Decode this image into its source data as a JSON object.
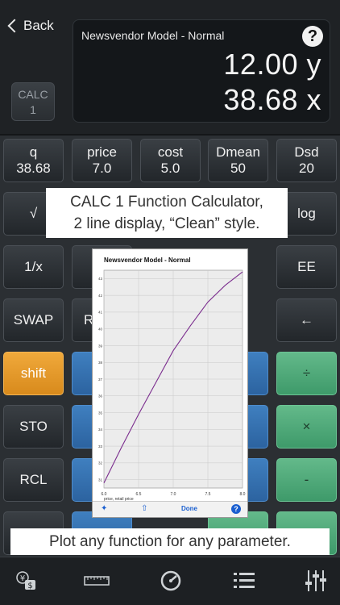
{
  "header": {
    "back_label": "Back",
    "calc_chip": {
      "line1": "CALC",
      "line2": "1"
    }
  },
  "display": {
    "title": "Newsvendor Model - Normal",
    "help_icon": "?",
    "line_y": "12.00 y",
    "line_x": "38.68 x"
  },
  "variables": [
    {
      "name": "q",
      "value": "38.68"
    },
    {
      "name": "price",
      "value": "7.0"
    },
    {
      "name": "cost",
      "value": "5.0"
    },
    {
      "name": "Dmean",
      "value": "50"
    },
    {
      "name": "Dsd",
      "value": "20"
    }
  ],
  "keys": {
    "sqrt": "√",
    "log": "log",
    "recip": "1/x",
    "ee": "EE",
    "swap": "SWAP",
    "r_partial": "R",
    "backspace": "←",
    "shift": "shift",
    "divide": "÷",
    "sto": "STO",
    "multiply": "×",
    "rcl": "RCL",
    "minus": "-"
  },
  "captions": {
    "top": "CALC 1 Function Calculator,\n2 line display, “Clean” style.",
    "bottom": "Plot any function for any parameter."
  },
  "plot": {
    "done_label": "Done",
    "help_label": "?"
  },
  "chart_data": {
    "type": "line",
    "title": "Newsvendor Model - Normal",
    "xlabel": "price, retail price",
    "ylabel": "",
    "xlim": [
      6.0,
      8.0
    ],
    "ylim": [
      30.5,
      43.5
    ],
    "xticks": [
      "6.0",
      "6.5",
      "7.0",
      "7.5",
      "8.0"
    ],
    "yticks": [
      "31",
      "32",
      "33",
      "34",
      "35",
      "36",
      "37",
      "38",
      "39",
      "40",
      "41",
      "42",
      "43"
    ],
    "grid": true,
    "series": [
      {
        "color": "#7b2d8e",
        "x": [
          6.0,
          6.25,
          6.5,
          6.75,
          7.0,
          7.25,
          7.5,
          7.75,
          8.0
        ],
        "y": [
          30.8,
          32.9,
          34.9,
          36.8,
          38.7,
          40.2,
          41.6,
          42.6,
          43.4
        ]
      }
    ]
  },
  "colors": {
    "accent_blue": "#2c63a0",
    "accent_green": "#3e9a6a",
    "accent_orange": "#d88a1c",
    "curve": "#7b2d8e"
  },
  "tabs": [
    {
      "icon": "currency-exchange-icon"
    },
    {
      "icon": "ruler-icon"
    },
    {
      "icon": "gauge-icon"
    },
    {
      "icon": "list-icon"
    },
    {
      "icon": "sliders-icon"
    }
  ]
}
